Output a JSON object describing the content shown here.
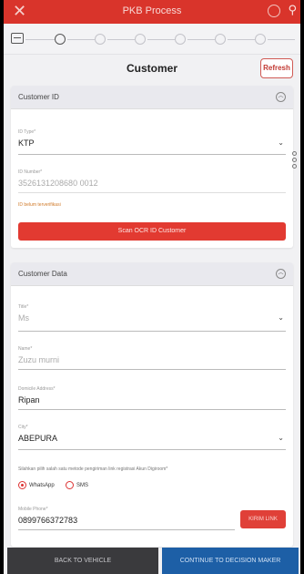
{
  "appbar": {
    "title": "PKB Process"
  },
  "page": {
    "title": "Customer",
    "refresh_label": "Refresh"
  },
  "customer_id": {
    "section_title": "Customer ID",
    "id_type": {
      "label": "ID Type*",
      "value": "KTP"
    },
    "id_number": {
      "label": "ID Number*",
      "value": "3526131208680 0012"
    },
    "warning": "ID belum terverifikasi",
    "scan_button": "Scan OCR ID Customer"
  },
  "customer_data": {
    "section_title": "Customer Data",
    "title_field": {
      "label": "Title*",
      "value": "Ms"
    },
    "name_field": {
      "label": "Name*",
      "value": "Zuzu murni"
    },
    "address_field": {
      "label": "Domicile Address*",
      "value": "Ripan"
    },
    "city_field": {
      "label": "City*",
      "value": "ABEPURA"
    },
    "method_hint": "Silahkan pilih salah satu metode pengiriman link registrasi Akun Digiroom*",
    "radio_whatsapp": "WhatsApp",
    "radio_sms": "SMS",
    "phone_field": {
      "label": "Mobile Phone*",
      "value": "0899766372783"
    },
    "kirim_button": "KIRIM LINK"
  },
  "footer": {
    "back_label": "BACK TO VEHICLE",
    "continue_label": "CONTINUE TO DECISION MAKER"
  }
}
